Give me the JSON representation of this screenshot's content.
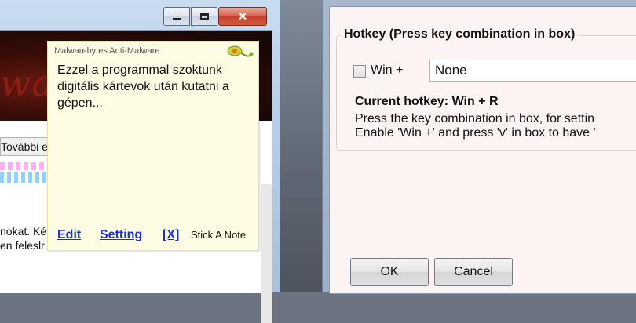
{
  "browser_window": {
    "close_glyph": "✕",
    "banner_text": "wa",
    "link_bar_text": "További e",
    "page_text_line1": "nokat. Ké",
    "page_text_line2": "en feleslr"
  },
  "sticky_note": {
    "app_name": "Malwarebytes Anti-Malware",
    "body": "Ezzel a programmal szoktunk digitális kártevok után kutatni a gépen...",
    "links": {
      "edit": "Edit",
      "setting": "Setting",
      "close": "[X]"
    },
    "brand": "Stick A Note"
  },
  "hotkey_dialog": {
    "group_title": "Hotkey (Press key combination in box)",
    "win_checkbox_label": "Win +",
    "hotkey_value": "None",
    "current_hotkey": "Current hotkey: Win + R",
    "help_line1": "Press the key combination in box, for settin",
    "help_line2": "Enable 'Win +' and press 'v' in box to have '",
    "ok_label": "OK",
    "cancel_label": "Cancel"
  },
  "colors": {
    "note_background": "#fffce4",
    "note_link": "#1a2fd6",
    "dialog_background": "#fcf4f2",
    "close_button": "#c4402a"
  }
}
